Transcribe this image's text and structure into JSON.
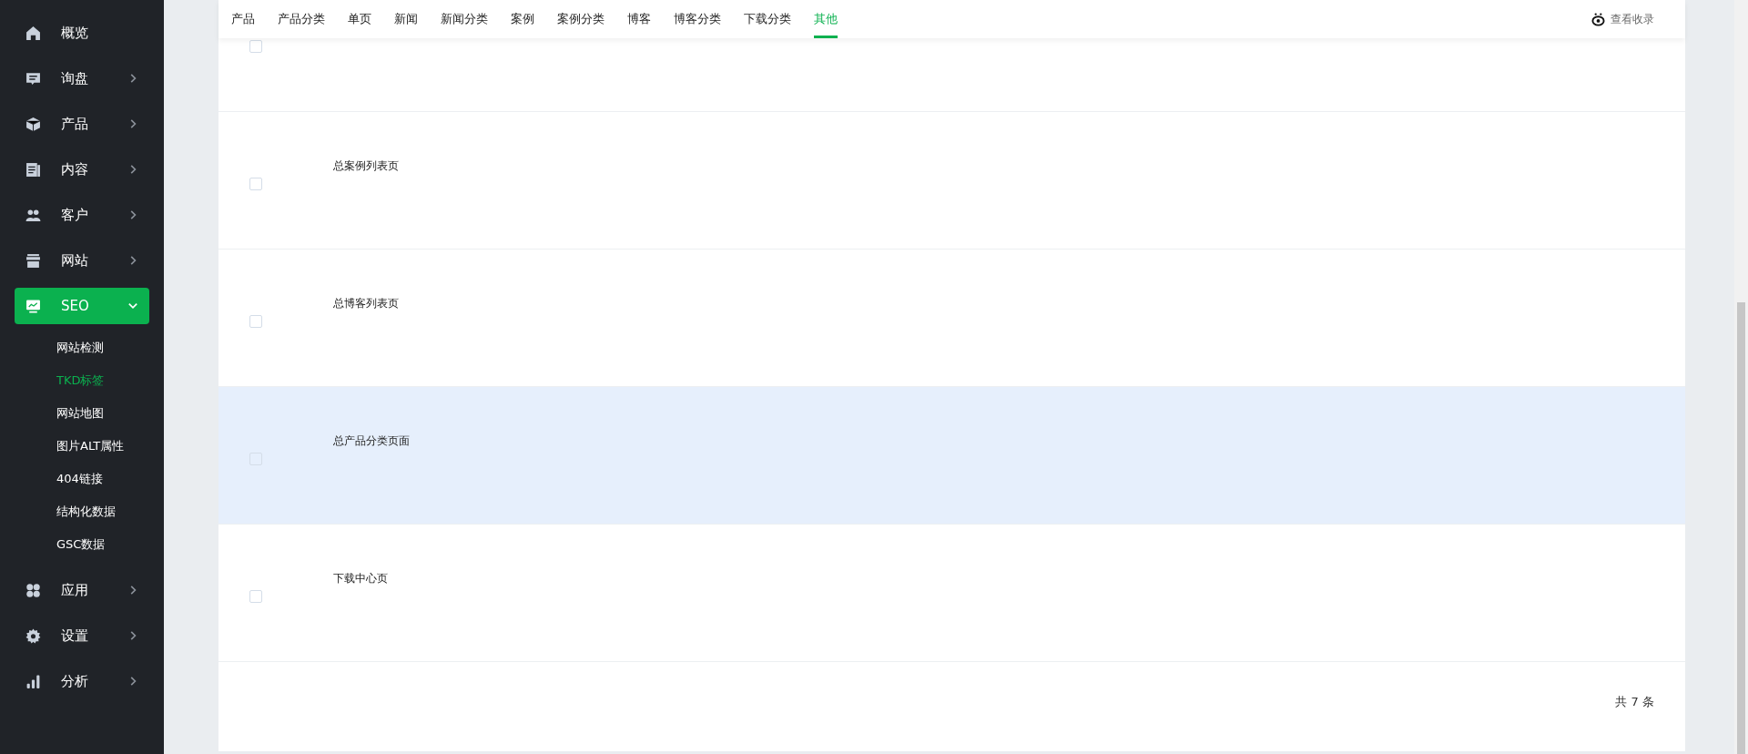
{
  "sidebar": {
    "items": [
      {
        "kind": "home",
        "label": "概览",
        "selected": false
      },
      {
        "kind": "chat",
        "label": "询盘",
        "expanded": false,
        "selected": false
      },
      {
        "kind": "box",
        "label": "产品",
        "expanded": false,
        "selected": false
      },
      {
        "kind": "doc",
        "label": "内容",
        "expanded": false,
        "selected": false
      },
      {
        "kind": "users",
        "label": "客户",
        "expanded": false,
        "selected": false
      },
      {
        "kind": "store",
        "label": "网站",
        "expanded": false,
        "selected": false
      },
      {
        "kind": "monitor",
        "label": "SEO",
        "expanded": true,
        "selected": true,
        "children": [
          {
            "label": "网站检测",
            "selected": false
          },
          {
            "label": "TKD标签",
            "selected": true
          },
          {
            "label": "网站地图",
            "selected": false
          },
          {
            "label": "图片ALT属性",
            "selected": false
          },
          {
            "label": "404链接",
            "selected": false
          },
          {
            "label": "结构化数据",
            "selected": false
          },
          {
            "label": "GSC数据",
            "selected": false
          }
        ]
      },
      {
        "kind": "apps",
        "label": "应用",
        "expanded": false,
        "selected": false
      },
      {
        "kind": "gear",
        "label": "设置",
        "expanded": false,
        "selected": false
      },
      {
        "kind": "bars",
        "label": "分析",
        "expanded": false,
        "selected": false
      }
    ]
  },
  "tabs": [
    {
      "label": "产品",
      "selected": false
    },
    {
      "label": "产品分类",
      "selected": false
    },
    {
      "label": "单页",
      "selected": false
    },
    {
      "label": "新闻",
      "selected": false
    },
    {
      "label": "新闻分类",
      "selected": false
    },
    {
      "label": "案例",
      "selected": false
    },
    {
      "label": "案例分类",
      "selected": false
    },
    {
      "label": "博客",
      "selected": false
    },
    {
      "label": "博客分类",
      "selected": false
    },
    {
      "label": "下载分类",
      "selected": false
    },
    {
      "label": "其他",
      "selected": true
    }
  ],
  "view_index_link": "查看收录",
  "table": {
    "rows": [
      {
        "checked": false,
        "highlighted": false
      },
      {
        "page": "总案例列表页",
        "checked": false,
        "highlighted": false
      },
      {
        "page": "总博客列表页",
        "checked": false,
        "highlighted": false
      },
      {
        "page": "总产品分类页面",
        "checked": false,
        "highlighted": true
      },
      {
        "page": "下载中心页",
        "checked": false,
        "highlighted": false
      }
    ]
  },
  "pagination": {
    "total": "共 7 条"
  }
}
